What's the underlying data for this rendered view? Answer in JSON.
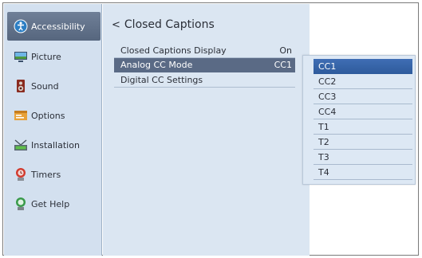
{
  "sidebar": {
    "items": [
      {
        "label": "Accessibility",
        "icon": "accessibility-icon",
        "active": true
      },
      {
        "label": "Picture",
        "icon": "picture-icon"
      },
      {
        "label": "Sound",
        "icon": "sound-icon"
      },
      {
        "label": "Options",
        "icon": "options-icon"
      },
      {
        "label": "Installation",
        "icon": "installation-icon"
      },
      {
        "label": "Timers",
        "icon": "timers-icon"
      },
      {
        "label": "Get Help",
        "icon": "help-icon"
      }
    ]
  },
  "panel": {
    "title": "Closed Captions",
    "rows": [
      {
        "label": "Closed Captions Display",
        "value": "On"
      },
      {
        "label": "Analog CC Mode",
        "value": "CC1",
        "selected": true
      },
      {
        "label": "Digital CC Settings",
        "value": ""
      }
    ]
  },
  "dropdown": {
    "options": [
      "CC1",
      "CC2",
      "CC3",
      "CC4",
      "T1",
      "T2",
      "T3",
      "T4"
    ],
    "selected": "CC1"
  },
  "colors": {
    "sidebar_bg": "#d3e0ef",
    "panel_bg": "#dbe6f2",
    "active_item": "#5a6a85",
    "dropdown_selected": "#3466ad"
  }
}
